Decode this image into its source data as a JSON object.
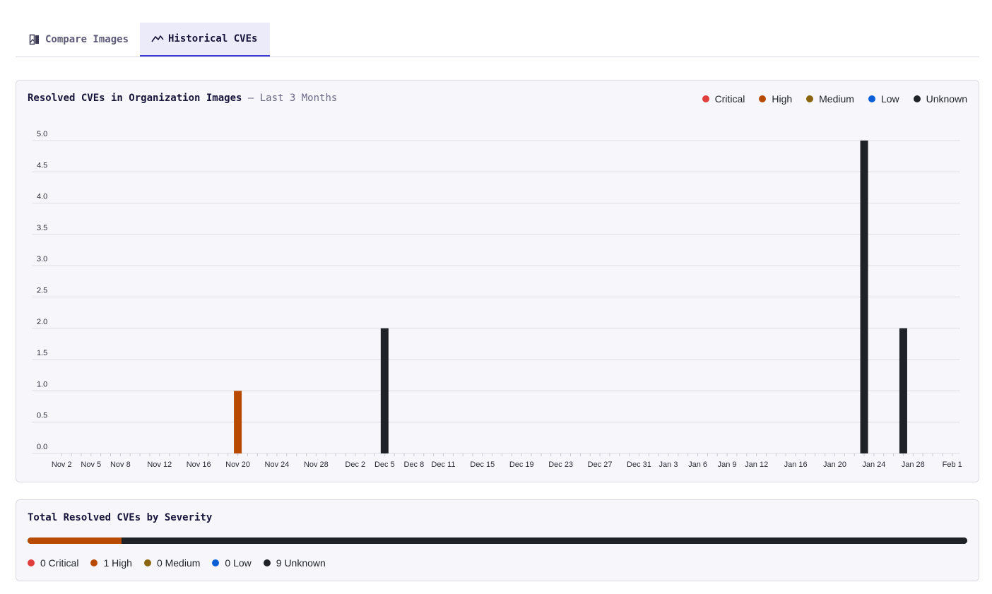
{
  "tabs": [
    {
      "label": "Compare Images",
      "icon": "compare-images-icon",
      "active": false
    },
    {
      "label": "Historical CVEs",
      "icon": "trend-line-icon",
      "active": true
    }
  ],
  "chart_card": {
    "title": "Resolved CVEs in Organization Images",
    "subtitle": "— Last 3 Months"
  },
  "colors": {
    "Critical": "#e03d3d",
    "High": "#b84a00",
    "Medium": "#8a6510",
    "Low": "#0a5fd6",
    "Unknown": "#1f2226"
  },
  "chart_data": {
    "type": "bar",
    "title": "Resolved CVEs in Organization Images",
    "subtitle": "— Last 3 Months",
    "legend": [
      "Critical",
      "High",
      "Medium",
      "Low",
      "Unknown"
    ],
    "legend_position": "top-right",
    "grid": true,
    "ylim": [
      0,
      5
    ],
    "y_ticks": [
      "0.0",
      "0.5",
      "1.0",
      "1.5",
      "2.0",
      "2.5",
      "3.0",
      "3.5",
      "4.0",
      "4.5",
      "5.0"
    ],
    "x_tick_labels": [
      "Nov 2",
      "Nov 5",
      "Nov 8",
      "Nov 12",
      "Nov 16",
      "Nov 20",
      "Nov 24",
      "Nov 28",
      "Dec 2",
      "Dec 5",
      "Dec 8",
      "Dec 11",
      "Dec 15",
      "Dec 19",
      "Dec 23",
      "Dec 27",
      "Dec 31",
      "Jan 3",
      "Jan 6",
      "Jan 9",
      "Jan 12",
      "Jan 16",
      "Jan 20",
      "Jan 24",
      "Jan 28",
      "Feb 1"
    ],
    "x_tick_dates": [
      "Nov 2",
      "Nov 5",
      "Nov 8",
      "Nov 12",
      "Nov 16",
      "Nov 20",
      "Nov 24",
      "Nov 28",
      "Dec 2",
      "Dec 5",
      "Dec 8",
      "Dec 11",
      "Dec 15",
      "Dec 19",
      "Dec 23",
      "Dec 27",
      "Dec 31",
      "Jan 3",
      "Jan 6",
      "Jan 9",
      "Jan 12",
      "Jan 16",
      "Jan 20",
      "Jan 24",
      "Jan 28",
      "Feb 1"
    ],
    "bars": [
      {
        "date": "Nov 20",
        "series": "High",
        "value": 1
      },
      {
        "date": "Dec 5",
        "series": "Unknown",
        "value": 2
      },
      {
        "date": "Jan 23",
        "series": "Unknown",
        "value": 5
      },
      {
        "date": "Jan 27",
        "series": "Unknown",
        "value": 2
      }
    ]
  },
  "total_card": {
    "title": "Total Resolved CVEs by Severity",
    "severities": [
      {
        "name": "Critical",
        "count": 0,
        "label": "0 Critical"
      },
      {
        "name": "High",
        "count": 1,
        "label": "1 High"
      },
      {
        "name": "Medium",
        "count": 0,
        "label": "0 Medium"
      },
      {
        "name": "Low",
        "count": 0,
        "label": "0 Low"
      },
      {
        "name": "Unknown",
        "count": 9,
        "label": "9 Unknown"
      }
    ]
  }
}
